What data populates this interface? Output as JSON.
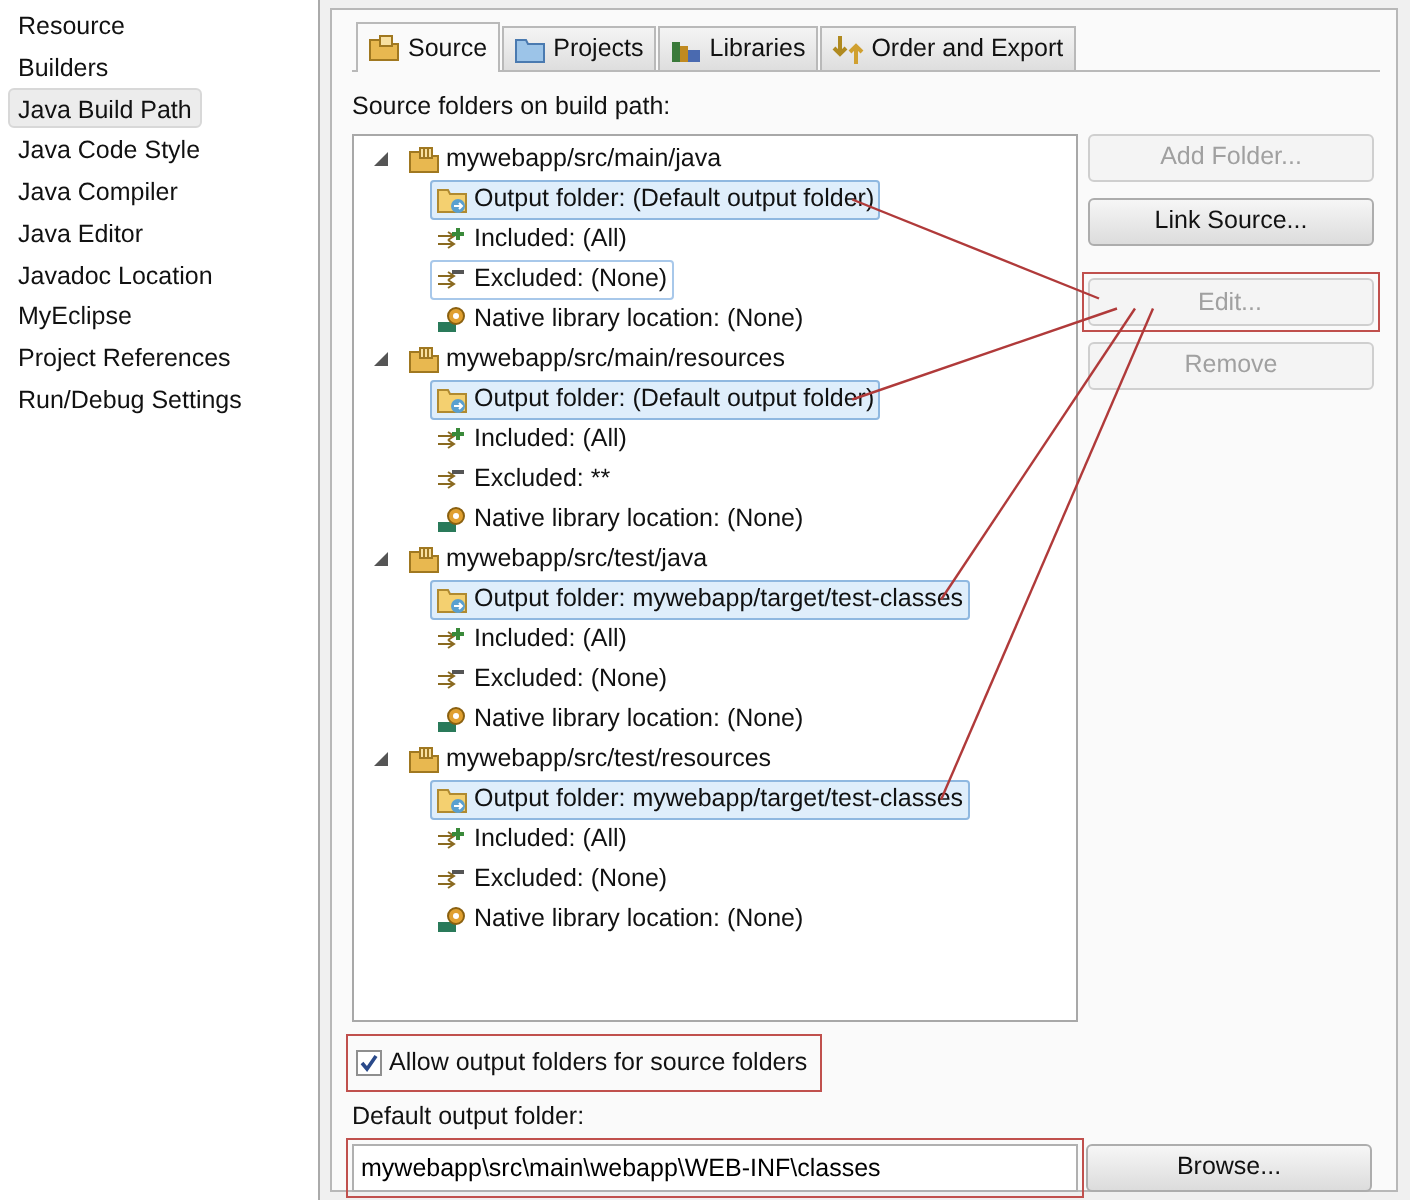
{
  "sidebar": {
    "items": [
      {
        "label": "Resource",
        "selected": false
      },
      {
        "label": "Builders",
        "selected": false
      },
      {
        "label": "Java Build Path",
        "selected": true
      },
      {
        "label": "Java Code Style",
        "selected": false
      },
      {
        "label": "Java Compiler",
        "selected": false
      },
      {
        "label": "Java Editor",
        "selected": false
      },
      {
        "label": "Javadoc Location",
        "selected": false
      },
      {
        "label": "MyEclipse",
        "selected": false
      },
      {
        "label": "Project References",
        "selected": false
      },
      {
        "label": "Run/Debug Settings",
        "selected": false
      }
    ]
  },
  "tabs": [
    {
      "label": "Source",
      "kind": "source",
      "selected": true
    },
    {
      "label": "Projects",
      "kind": "projects",
      "selected": false
    },
    {
      "label": "Libraries",
      "kind": "libraries",
      "selected": false
    },
    {
      "label": "Order and Export",
      "kind": "order",
      "selected": false
    }
  ],
  "tree_label": "Source folders on build path:",
  "tree": [
    {
      "label": "mywebapp/src/main/java",
      "expanded": true,
      "children": [
        {
          "label": "Output folder: (Default output folder)",
          "kind": "output",
          "selected": true,
          "focused": false,
          "highlighted": true
        },
        {
          "label": "Included: (All)",
          "kind": "included",
          "selected": false,
          "focused": false,
          "highlighted": false
        },
        {
          "label": "Excluded: (None)",
          "kind": "excluded",
          "selected": false,
          "focused": true,
          "highlighted": false
        },
        {
          "label": "Native library location: (None)",
          "kind": "native",
          "selected": false,
          "focused": false,
          "highlighted": false
        }
      ]
    },
    {
      "label": "mywebapp/src/main/resources",
      "expanded": true,
      "children": [
        {
          "label": "Output folder: (Default output folder)",
          "kind": "output",
          "selected": true,
          "focused": false,
          "highlighted": true
        },
        {
          "label": "Included: (All)",
          "kind": "included",
          "selected": false,
          "focused": false,
          "highlighted": false
        },
        {
          "label": "Excluded: **",
          "kind": "excluded",
          "selected": false,
          "focused": false,
          "highlighted": false
        },
        {
          "label": "Native library location: (None)",
          "kind": "native",
          "selected": false,
          "focused": false,
          "highlighted": false
        }
      ]
    },
    {
      "label": "mywebapp/src/test/java",
      "expanded": true,
      "children": [
        {
          "label": "Output folder: mywebapp/target/test-classes",
          "kind": "output",
          "selected": true,
          "focused": false,
          "highlighted": true
        },
        {
          "label": "Included: (All)",
          "kind": "included",
          "selected": false,
          "focused": false,
          "highlighted": false
        },
        {
          "label": "Excluded: (None)",
          "kind": "excluded",
          "selected": false,
          "focused": false,
          "highlighted": false
        },
        {
          "label": "Native library location: (None)",
          "kind": "native",
          "selected": false,
          "focused": false,
          "highlighted": false
        }
      ]
    },
    {
      "label": "mywebapp/src/test/resources",
      "expanded": true,
      "children": [
        {
          "label": "Output folder: mywebapp/target/test-classes",
          "kind": "output",
          "selected": true,
          "focused": false,
          "highlighted": true
        },
        {
          "label": "Included: (All)",
          "kind": "included",
          "selected": false,
          "focused": false,
          "highlighted": false
        },
        {
          "label": "Excluded: (None)",
          "kind": "excluded",
          "selected": false,
          "focused": false,
          "highlighted": false
        },
        {
          "label": "Native library location: (None)",
          "kind": "native",
          "selected": false,
          "focused": false,
          "highlighted": false
        }
      ]
    }
  ],
  "side_buttons": [
    {
      "label": "Add Folder...",
      "disabled": true,
      "highlighted": false
    },
    {
      "label": "Link Source...",
      "disabled": false,
      "highlighted": false
    },
    {
      "label": "Edit...",
      "disabled": true,
      "highlighted": true
    },
    {
      "label": "Remove",
      "disabled": true,
      "highlighted": false
    }
  ],
  "allow_output": {
    "label": "Allow output folders for source folders",
    "checked": true,
    "highlighted": true
  },
  "default_output": {
    "label": "Default output folder:",
    "value": "mywebapp\\src\\main\\webapp\\WEB-INF\\classes",
    "highlighted": true
  },
  "browse_button": {
    "label": "Browse..."
  }
}
